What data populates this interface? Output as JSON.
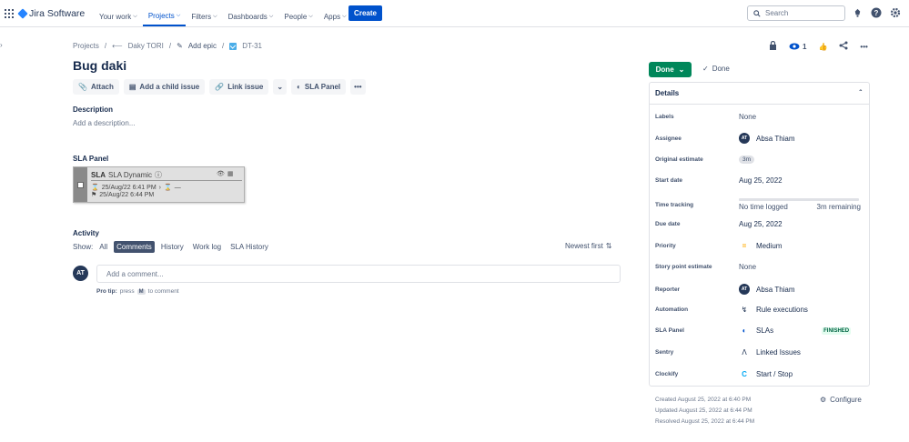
{
  "app": {
    "name": "Jira Software"
  },
  "nav": {
    "items": [
      {
        "label": "Your work"
      },
      {
        "label": "Projects"
      },
      {
        "label": "Filters"
      },
      {
        "label": "Dashboards"
      },
      {
        "label": "People"
      },
      {
        "label": "Apps"
      }
    ],
    "create_label": "Create",
    "search_placeholder": "Search"
  },
  "breadcrumb": {
    "projects": "Projects",
    "project": "Daky TORI",
    "epic": "Add epic",
    "issue_key": "DT-31"
  },
  "issue": {
    "title": "Bug daki",
    "actions": [
      "Attach",
      "Add a child issue",
      "Link issue",
      "SLA Panel"
    ],
    "description_label": "Description",
    "description_placeholder": "Add a description..."
  },
  "sla_panel": {
    "label": "SLA Panel",
    "title_bold": "SLA",
    "title_rest": "SLA Dynamic",
    "start": "25/Aug/22 6:41 PM",
    "end": "25/Aug/22 6:44 PM",
    "dash": "—"
  },
  "activity": {
    "label": "Activity",
    "show_label": "Show:",
    "tabs": [
      "All",
      "Comments",
      "History",
      "Work log",
      "SLA History"
    ],
    "sort_label": "Newest first",
    "avatar_initials": "AT",
    "comment_placeholder": "Add a comment...",
    "protip_bold": "Pro tip:",
    "protip_press": "press",
    "protip_key": "M",
    "protip_rest": "to comment"
  },
  "header_right": {
    "watch_count": "1"
  },
  "status": {
    "button": "Done",
    "label": "Done"
  },
  "details": {
    "title": "Details",
    "labels": {
      "label": "Labels",
      "value": "None"
    },
    "assignee": {
      "label": "Assignee",
      "initials": "AT",
      "value": "Absa Thiam"
    },
    "original_estimate": {
      "label": "Original estimate",
      "value": "3m"
    },
    "start_date": {
      "label": "Start date",
      "value": "Aug 25, 2022"
    },
    "time_tracking": {
      "label": "Time tracking",
      "logged": "No time logged",
      "remaining": "3m remaining"
    },
    "due_date": {
      "label": "Due date",
      "value": "Aug 25, 2022"
    },
    "priority": {
      "label": "Priority",
      "value": "Medium"
    },
    "story_points": {
      "label": "Story point estimate",
      "value": "None"
    },
    "reporter": {
      "label": "Reporter",
      "initials": "AT",
      "value": "Absa Thiam"
    },
    "automation": {
      "label": "Automation",
      "value": "Rule executions"
    },
    "sla_panel": {
      "label": "SLA Panel",
      "value": "SLAs",
      "badge": "FINISHED"
    },
    "sentry": {
      "label": "Sentry",
      "value": "Linked Issues"
    },
    "clockify": {
      "label": "Clockify",
      "value": "Start / Stop"
    }
  },
  "meta": {
    "created": "Created August 25, 2022 at 6:40 PM",
    "updated": "Updated August 25, 2022 at 6:44 PM",
    "resolved": "Resolved August 25, 2022 at 6:44 PM",
    "configure": "Configure"
  },
  "colors": {
    "brand": "#0052cc",
    "done": "#00875a",
    "priority_medium": "#ffab00"
  }
}
